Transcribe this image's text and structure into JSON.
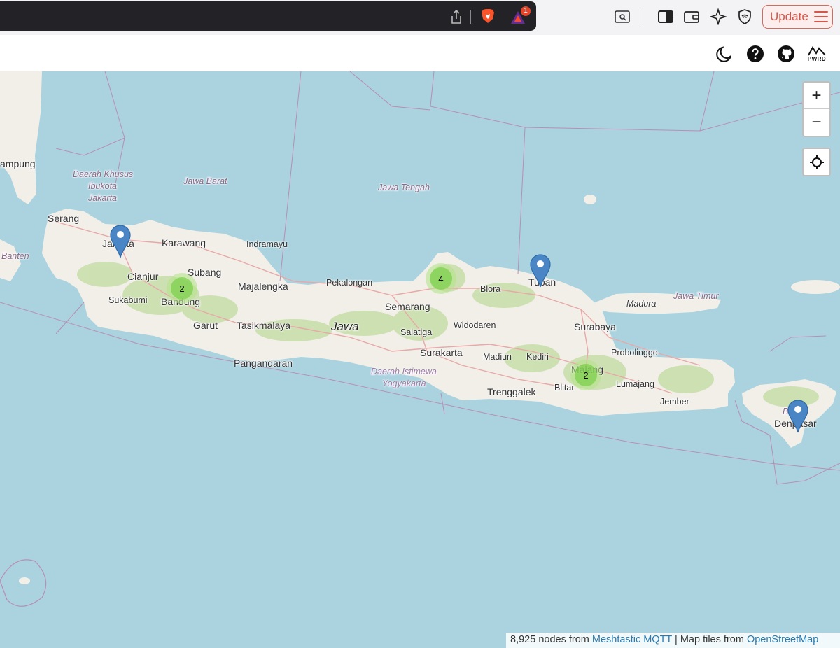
{
  "browser": {
    "update_label": "Update",
    "notification_count": "1",
    "icons": [
      "share-icon",
      "brave-lion-icon",
      "rewards-icon",
      "reader-mode-icon",
      "sidebar-icon",
      "wallet-icon",
      "leo-ai-icon",
      "vpn-icon",
      "menu-icon"
    ],
    "accent_color": "#d3574b"
  },
  "header": {
    "icons": [
      "dark-mode-icon",
      "help-icon",
      "github-icon",
      "pwrd-logo"
    ],
    "logo_text": "PWRD"
  },
  "map": {
    "zoom_in_label": "+",
    "zoom_out_label": "−",
    "places": {
      "lampung": "ampung",
      "dki": "Daerah Khusus",
      "dki2": "Ibukota",
      "dki3": "Jakarta",
      "jawa_barat": "Jawa Barat",
      "jawa_tengah": "Jawa Tengah",
      "serang": "Serang",
      "jakarta": "Jakarta",
      "karawang": "Karawang",
      "indramayu": "Indramayu",
      "banten": "Banten",
      "cianjur": "Cianjur",
      "subang": "Subang",
      "majalengka": "Majalengka",
      "pekalongan": "Pekalongan",
      "sukabumi": "Sukabumi",
      "bandung": "Bandung",
      "garut": "Garut",
      "tasikmalaya": "Tasikmalaya",
      "jawa": "Jawa",
      "semarang": "Semarang",
      "blora": "Blora",
      "tuban": "Tuban",
      "madura": "Madura",
      "jawa_timur": "Jawa Timur",
      "widodaren": "Widodaren",
      "salatiga": "Salatiga",
      "surabaya": "Surabaya",
      "surakarta": "Surakarta",
      "probolinggo": "Probolinggo",
      "madiun": "Madiun",
      "kediri": "Kediri",
      "pangandaran": "Pangandaran",
      "diy": "Daerah Istimewa",
      "diy2": "Yogyakarta",
      "malang": "Malang",
      "lumajang": "Lumajang",
      "trenggalek": "Trenggalek",
      "blitar": "Blitar",
      "jember": "Jember",
      "bali": "Bali",
      "denpasar": "Denpasar"
    },
    "clusters": [
      {
        "name": "cluster-bandung",
        "count": "2"
      },
      {
        "name": "cluster-pati",
        "count": "4"
      },
      {
        "name": "cluster-malang",
        "count": "2"
      }
    ],
    "marker_color": "#4a86c5"
  },
  "attribution": {
    "prefix": "8,925 nodes from ",
    "mqtt_link": "Meshtastic MQTT",
    "middle": " | Map tiles from ",
    "osm_link": "OpenStreetMap"
  }
}
